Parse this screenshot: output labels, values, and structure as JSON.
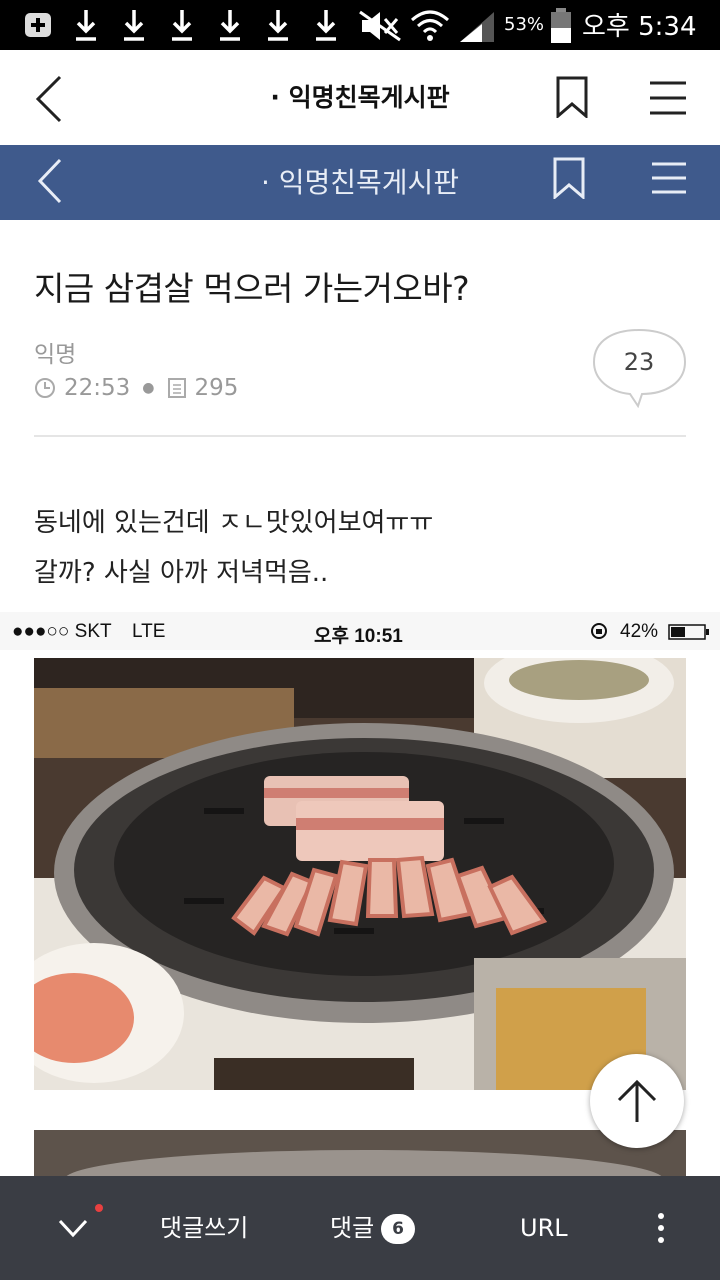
{
  "status_bar": {
    "battery_percent": "53%",
    "time": "오후 5:34",
    "icons": [
      "notification-icon",
      "download-icon",
      "download-icon",
      "download-icon",
      "download-icon",
      "download-icon",
      "download-icon",
      "mute-icon",
      "wifi-icon",
      "signal-icon",
      "battery-icon"
    ]
  },
  "app_header": {
    "title": "· 익명친목게시판",
    "icons": [
      "back-icon",
      "bookmark-icon",
      "menu-icon"
    ]
  },
  "sticky_header": {
    "title": "· 익명친목게시판"
  },
  "post": {
    "title": "지금 삼겹살 먹으러 가는거오바?",
    "author": "익명",
    "time": "22:53",
    "views": "295",
    "comment_count": "23",
    "body_lines": [
      "동네에 있는건데 ㅈㄴ맛있어보여ㅠㅠ",
      "갈까? 사실 아까 저녁먹음.."
    ]
  },
  "embedded_screenshot": {
    "carrier": "●●●○○ SKT",
    "network": "LTE",
    "time": "오후 10:51",
    "battery": "42%"
  },
  "bottom_bar": {
    "write_comment": "댓글쓰기",
    "comments_label": "댓글",
    "comments_badge": "6",
    "url_label": "URL"
  },
  "colors": {
    "header_blue": "#3f5a8c",
    "bottom_bar": "#3a3d44",
    "notification_dot": "#e84040"
  }
}
